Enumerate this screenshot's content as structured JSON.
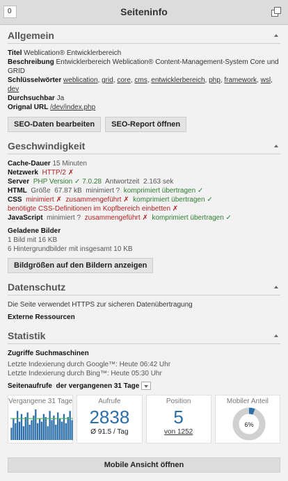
{
  "header": {
    "counter": "0",
    "title": "Seiteninfo"
  },
  "allgemein": {
    "heading": "Allgemein",
    "titel_label": "Titel",
    "titel_value": "Weblication® Entwicklerbereich",
    "beschreibung_label": "Beschreibung",
    "beschreibung_value": "Entwicklerbereich Weblication® Content-Management-System Core und GRID",
    "keywords_label": "Schlüsselwörter",
    "keywords": [
      "weblication",
      "grid",
      "core",
      "cms",
      "entwicklerbereich",
      "php",
      "framework",
      "wsl",
      "dev"
    ],
    "durchsuchbar_label": "Durchsuchbar",
    "durchsuchbar_value": "Ja",
    "url_label": "Orignal URL",
    "url_value": "/dev/index.php",
    "btn_edit": "SEO-Daten bearbeiten",
    "btn_report": "SEO-Report öffnen"
  },
  "speed": {
    "heading": "Geschwindigkeit",
    "cache_label": "Cache-Dauer",
    "cache_value": "15 Minuten",
    "netzwerk_label": "Netzwerk",
    "netzwerk_value": "HTTP/2 ✗",
    "server_label": "Server",
    "server_php": "PHP Version ✓ 7.0.28",
    "server_antwort": "Antwortzeit",
    "server_time": "2.163 sek",
    "html_label": "HTML",
    "html_size": "Größe",
    "html_size_value": "67.87 kB",
    "html_min": "minimiert ?",
    "html_comp": "komprimiert übertragen ✓",
    "css_label": "CSS",
    "css_min": "minimiert ✗",
    "css_merge": "zusammengeführt ✗",
    "css_comp": "komprimiert übertragen ✓",
    "css_note": "benötigte CSS-Definitionen im Kopfbereich einbetten ✗",
    "js_label": "JavaScript",
    "js_min": "minimiert ?",
    "js_merge": "zusammengeführt ✗",
    "js_comp": "komprimiert übertragen ✓",
    "images_label": "Geladene Bilder",
    "images_1": "1 Bild mit 16 KB",
    "images_2": "6 Hintergrundbilder mit insgesamt 10 KB",
    "btn_images": "Bildgrößen auf den Bildern anzeigen"
  },
  "datenschutz": {
    "heading": "Datenschutz",
    "https": "Die Seite verwendet HTTPS zur sicheren Datenübertragung",
    "extern": "Externe Ressourcen"
  },
  "statistik": {
    "heading": "Statistik",
    "zugriffe_label": "Zugriffe Suchmaschinen",
    "google": "Letzte Indexierung durch Google™: Heute 06:42 Uhr",
    "bing": "Letzte Indexierung durch Bing™: Heute 05:30 Uhr",
    "aufrufe_label": "Seitenaufrufe",
    "aufrufe_range": "der vergangenen 31 Tage",
    "card_vergangene": "Vergangene 31 Tage",
    "card_aufrufe": "Aufrufe",
    "aufrufe_total": "2838",
    "aufrufe_avg": "Ø 91.5 / Tag",
    "card_position": "Position",
    "position_value": "5",
    "position_of": "von 1252",
    "card_mobil": "Mobiler Anteil",
    "mobil_percent": "6%",
    "mobil_fraction": 0.06
  },
  "chart_data": {
    "type": "bar",
    "values": [
      40,
      70,
      55,
      95,
      60,
      85,
      45,
      75,
      90,
      50,
      65,
      80,
      100,
      55,
      70,
      60,
      85,
      75,
      45,
      95,
      65,
      80,
      50,
      90,
      70,
      60,
      85,
      55,
      75,
      95,
      65
    ],
    "average": 70
  },
  "footer": {
    "mobile_button": "Mobile Ansicht öffnen"
  },
  "colors": {
    "accent": "#2b6ea8",
    "red": "#b22222",
    "green": "#2e7d32"
  }
}
